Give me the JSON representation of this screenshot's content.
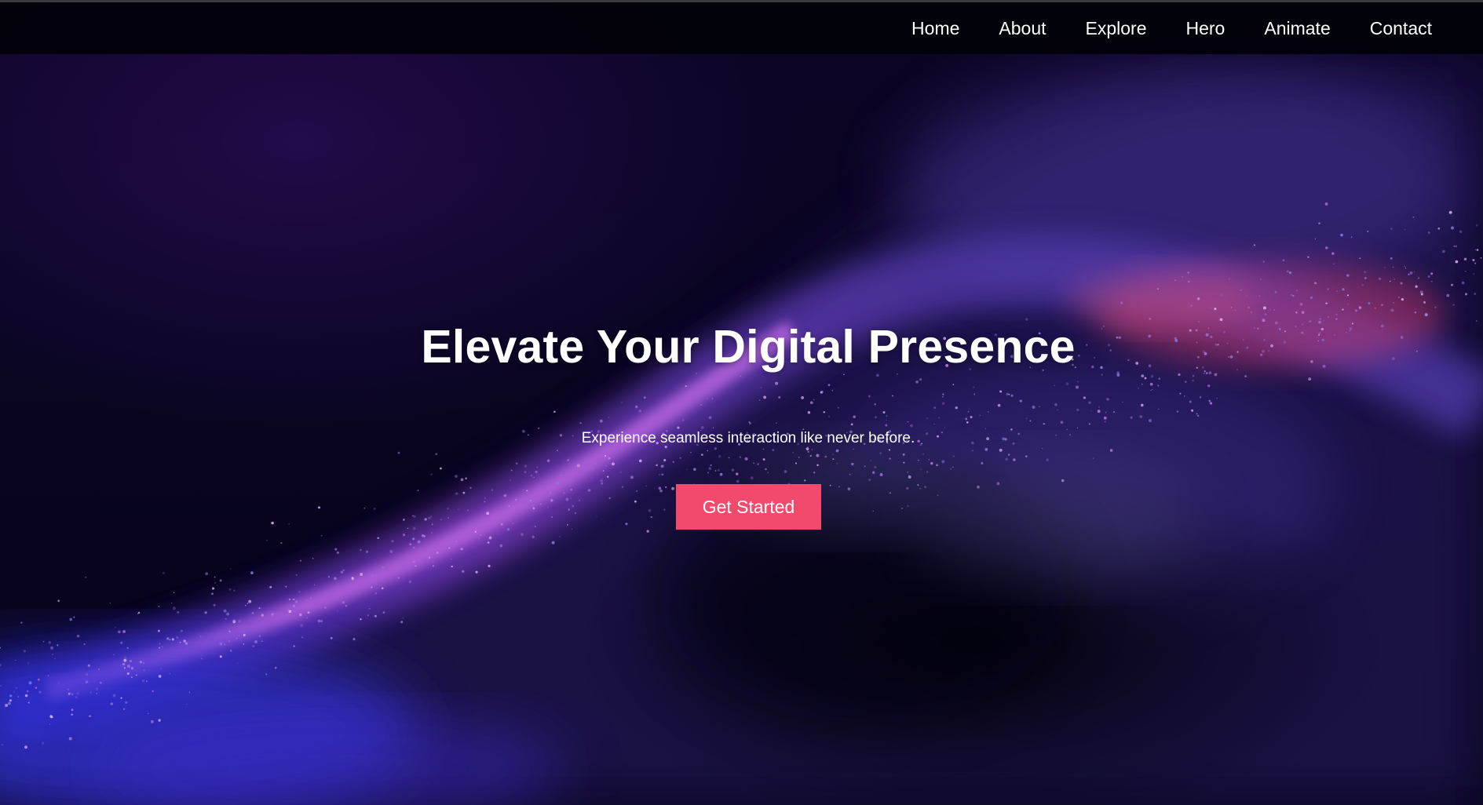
{
  "nav": {
    "items": [
      {
        "label": "Home"
      },
      {
        "label": "About"
      },
      {
        "label": "Explore"
      },
      {
        "label": "Hero"
      },
      {
        "label": "Animate"
      },
      {
        "label": "Contact"
      }
    ]
  },
  "hero": {
    "title": "Elevate Your Digital Presence",
    "subtitle": "Experience seamless interaction like never before.",
    "cta_label": "Get Started"
  },
  "colors": {
    "background": "#07041a",
    "navbar": "#02020a",
    "accent_button": "#f24a6c",
    "particle_purple": "#b35be0",
    "particle_blue": "#3a2fc8",
    "particle_pink": "#e0406a",
    "text": "#ffffff"
  }
}
